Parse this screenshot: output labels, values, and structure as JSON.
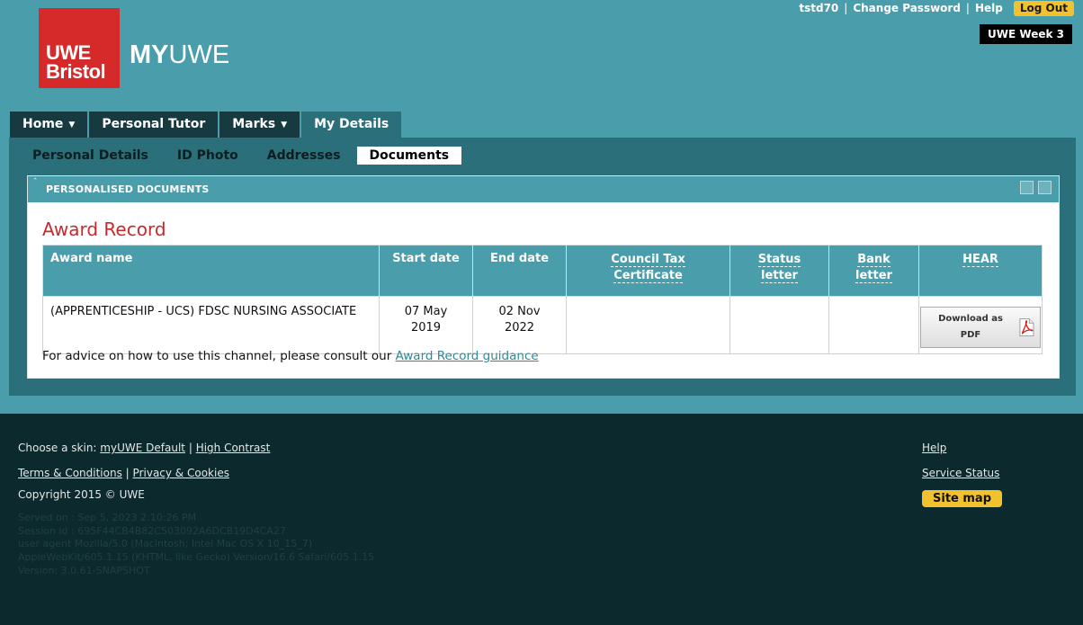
{
  "brand": {
    "logo_line1": "UWE",
    "logo_line2": "Bristol",
    "app_name_bold": "MY",
    "app_name_rest": "UWE",
    "logo_color": "#d62a2a"
  },
  "top_links": {
    "username": "tstd70",
    "change_password": "Change Password",
    "help": "Help",
    "logout": "Log Out",
    "separator": "|"
  },
  "week_badge": "UWE Week 3",
  "tabs": [
    {
      "label": "Home",
      "has_menu": true
    },
    {
      "label": "Personal Tutor",
      "has_menu": false
    },
    {
      "label": "Marks",
      "has_menu": true
    },
    {
      "label": "My Details",
      "has_menu": false,
      "active": true
    }
  ],
  "subtabs": [
    {
      "label": "Personal Details"
    },
    {
      "label": "ID Photo"
    },
    {
      "label": "Addresses"
    },
    {
      "label": "Documents",
      "active": true
    }
  ],
  "portlet": {
    "title": "PERSONALISED DOCUMENTS",
    "heading": "Award Record",
    "table": {
      "headers": {
        "award_name": "Award name",
        "start_date": "Start date",
        "end_date": "End date",
        "council_tax_1": "Council Tax",
        "council_tax_2": "Certificate",
        "status_1": "Status",
        "status_2": "letter",
        "bank_1": "Bank",
        "bank_2": "letter",
        "hear": "HEAR"
      },
      "rows": [
        {
          "award_name": "(APPRENTICESHIP - UCS) FDSC NURSING ASSOCIATE",
          "start_date_1": "07 May",
          "start_date_2": "2019",
          "end_date_1": "02 Nov",
          "end_date_2": "2022",
          "council_tax": "",
          "status_letter": "",
          "bank_letter": "",
          "hear_button": "Download as PDF"
        }
      ]
    },
    "advice_text": "For advice on how to use this channel, please consult our ",
    "advice_link": "Award Record guidance"
  },
  "footer": {
    "skin_label": "Choose a skin:",
    "skin_default": "myUWE Default",
    "skin_contrast": "High Contrast",
    "terms": "Terms & Conditions",
    "privacy": "Privacy & Cookies",
    "copyright": "Copyright 2015 © UWE",
    "help": "Help",
    "service_status": "Service Status",
    "site_map": "Site map",
    "server_info": [
      "Served on : Sep 5, 2023 2:10:26 PM",
      "Session id : 695F44CB4B82C503092A6DCB19D4CA27",
      "user agent Mozilla/5.0 (Macintosh; Intel Mac OS X 10_15_7)",
      "AppleWebKit/605.1.15 (KHTML, like Gecko) Version/16.6 Safari/605.1.15",
      "Version: 3.0.61-SNAPSHOT"
    ]
  }
}
